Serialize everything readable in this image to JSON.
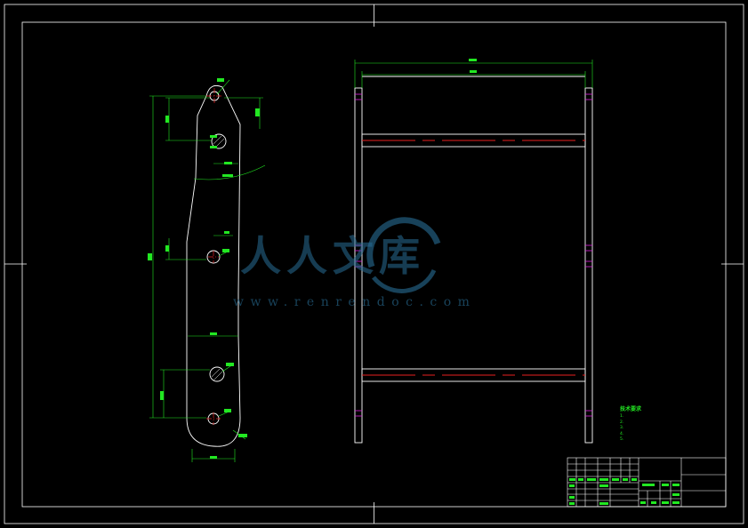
{
  "drawing": {
    "colors": {
      "background": "#000000",
      "frame": "#ffffff",
      "dimension": "#22e822",
      "centerline": "#e82020",
      "hidden_line": "#e020e0",
      "watermark": "#286e96"
    }
  },
  "watermark": {
    "text": "人人文库",
    "url": "www.renrendoc.com"
  },
  "notes": {
    "title": "技术要求",
    "lines": [
      "1.",
      "2.",
      "3.",
      "4.",
      "5."
    ]
  },
  "title_block": {
    "name": "",
    "drawing_no": ""
  }
}
